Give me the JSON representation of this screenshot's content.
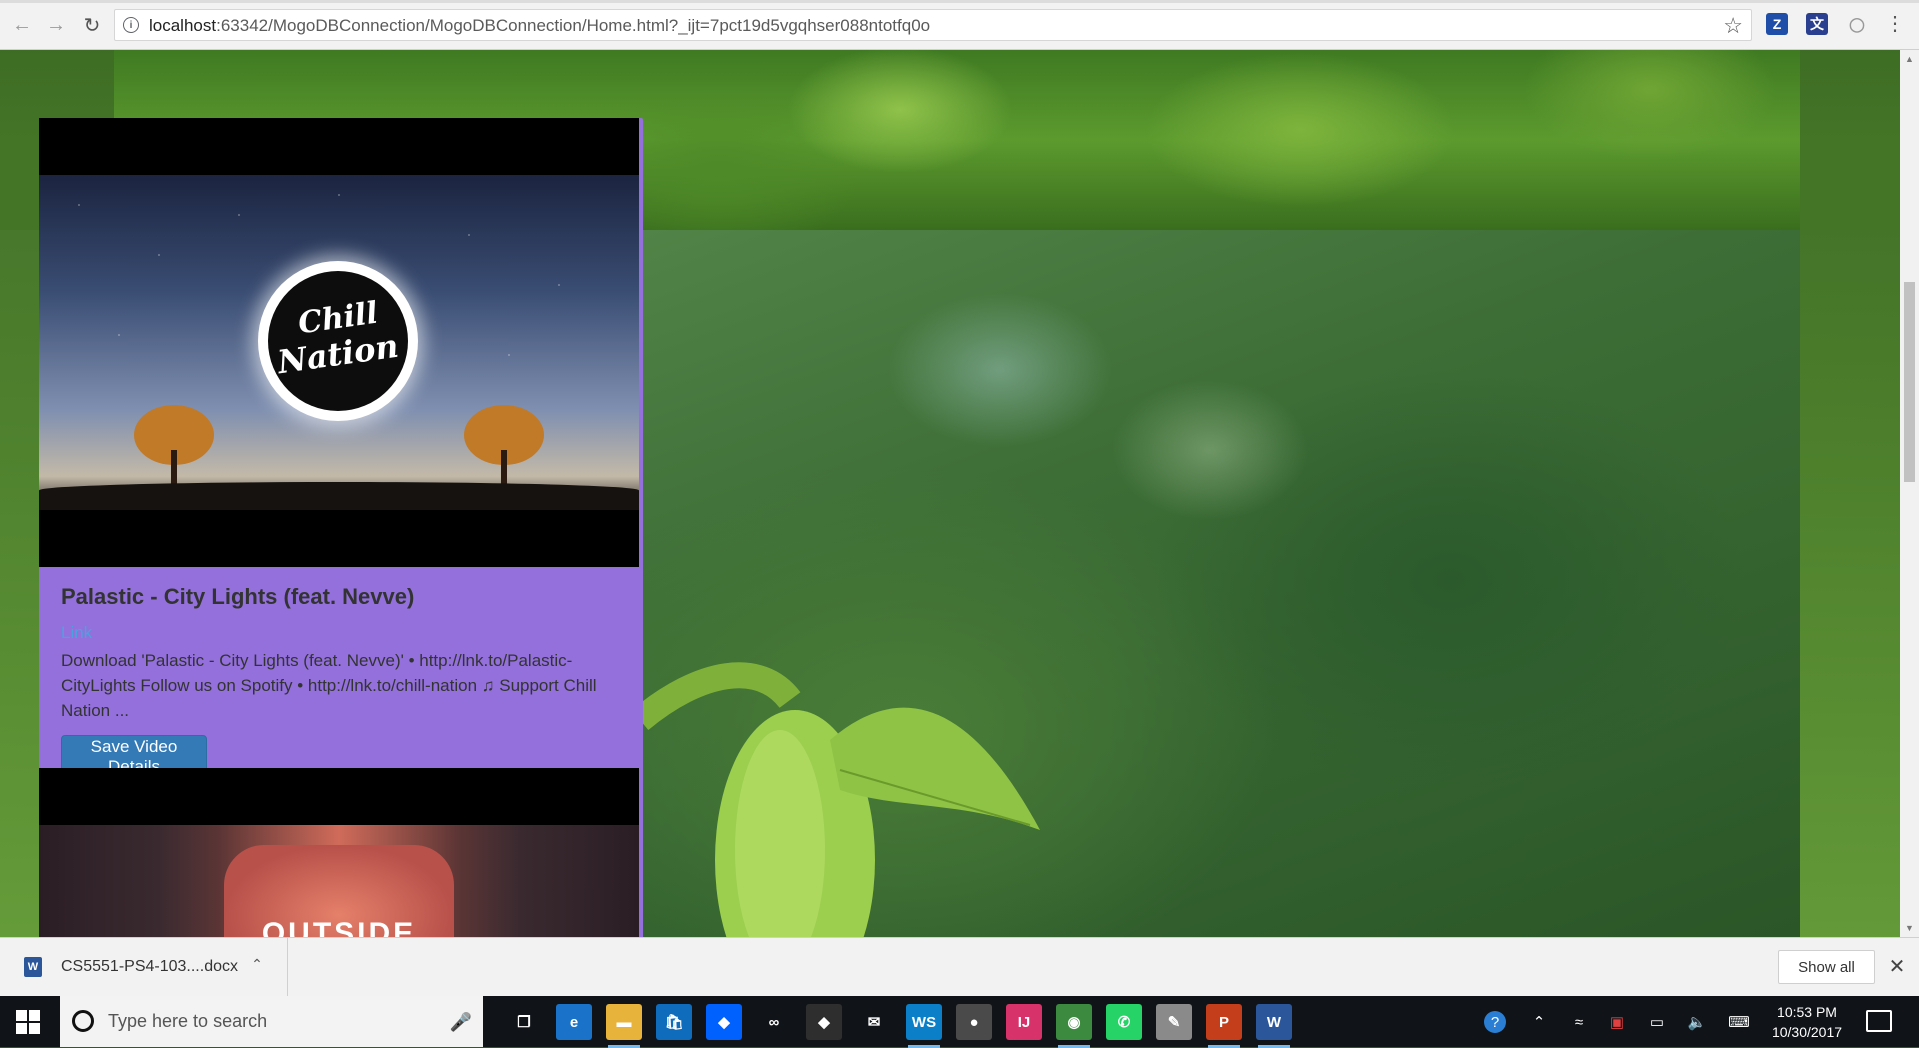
{
  "browser": {
    "url_host": "localhost",
    "url_rest": ":63342/MogoDBConnection/MogoDBConnection/Home.html?_ijt=7pct19d5vgqhser088ntotfq0o",
    "extensions": [
      {
        "name": "zotero-extension",
        "glyph": "Z",
        "color": "#1e4ea8"
      },
      {
        "name": "translate-extension",
        "glyph": "文",
        "color": "#2a3f8f"
      },
      {
        "name": "circle-extension",
        "glyph": "◯",
        "color": "#bbbbbb"
      }
    ]
  },
  "videos": [
    {
      "logo_line1": "Chill",
      "logo_line2": "Nation",
      "title": "Palastic - City Lights (feat. Nevve)",
      "link_label": "Link",
      "description": "Download 'Palastic - City Lights (feat. Nevve)' • http://lnk.to/Palastic-CityLights Follow us on Spotify • http://lnk.to/chill-nation ♫ Support Chill Nation ...",
      "save_label": "Save Video Details"
    },
    {
      "thumb_word": "OUTSIDE"
    }
  ],
  "download_bar": {
    "file_name": "CS5551-PS4-103....docx",
    "show_all_label": "Show all"
  },
  "taskbar": {
    "search_placeholder": "Type here to search",
    "time": "10:53 PM",
    "date": "10/30/2017",
    "apps": [
      {
        "name": "task-view-icon",
        "glyph": "❐",
        "color": "transparent"
      },
      {
        "name": "edge-icon",
        "glyph": "e",
        "color": "#1a73c8"
      },
      {
        "name": "file-explorer-icon",
        "glyph": "▬",
        "color": "#e8b33a"
      },
      {
        "name": "store-icon",
        "glyph": "🛍",
        "color": "#0f6cbd"
      },
      {
        "name": "dropbox-icon",
        "glyph": "◆",
        "color": "#0061fe"
      },
      {
        "name": "arduino-icon",
        "glyph": "∞",
        "color": "transparent"
      },
      {
        "name": "git-icon",
        "glyph": "◆",
        "color": "#2e2e2e"
      },
      {
        "name": "mail-icon",
        "glyph": "✉",
        "color": "transparent"
      },
      {
        "name": "webstorm-icon",
        "glyph": "WS",
        "color": "#0b7fc7"
      },
      {
        "name": "github-icon",
        "glyph": "●",
        "color": "#4a4a4a"
      },
      {
        "name": "intellij-icon",
        "glyph": "IJ",
        "color": "#d7336a"
      },
      {
        "name": "chrome-icon",
        "glyph": "◉",
        "color": "#3c8a3f"
      },
      {
        "name": "whatsapp-icon",
        "glyph": "✆",
        "color": "#25d366"
      },
      {
        "name": "paint-icon",
        "glyph": "✎",
        "color": "#8a8a8a"
      },
      {
        "name": "powerpoint-icon",
        "glyph": "P",
        "color": "#c43e1c"
      },
      {
        "name": "word-icon",
        "glyph": "W",
        "color": "#2b579a"
      }
    ]
  }
}
